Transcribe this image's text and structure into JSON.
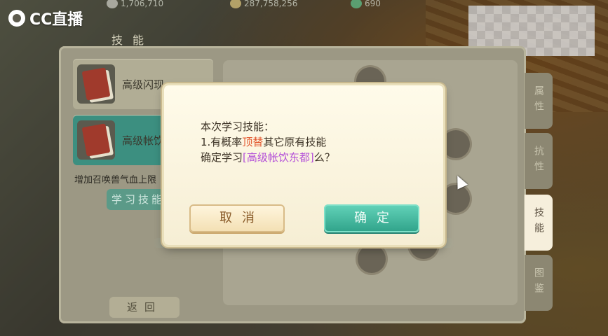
{
  "watermark": {
    "text": "CC直播"
  },
  "resources": [
    {
      "icon": "silver-coin-icon",
      "value": "1,706,710"
    },
    {
      "icon": "gold-coin-icon",
      "value": "287,758,256"
    },
    {
      "icon": "gem-icon",
      "value": "690"
    }
  ],
  "panel": {
    "title": "技能",
    "skills": [
      {
        "name": "高级闪现"
      },
      {
        "name": "高级帐饮东都"
      }
    ],
    "description": "增加召唤兽气血上限",
    "learn_button": "学习技能",
    "back_button": "返回"
  },
  "tabs": [
    "属性",
    "抗性",
    "技能",
    "图鉴"
  ],
  "dialog": {
    "line1": "本次学习技能：",
    "line2_prefix": "1.有概率",
    "line2_highlight": "顶替",
    "line2_suffix": "其它原有技能",
    "line3_prefix": "确定学习",
    "line3_skill": "[高级帐饮东都]",
    "line3_suffix": "么？",
    "cancel": "取消",
    "confirm": "确定"
  },
  "colors": {
    "confirm": "#2fa289",
    "highlight_red": "#e2572e",
    "highlight_purple": "#b34fd8"
  }
}
